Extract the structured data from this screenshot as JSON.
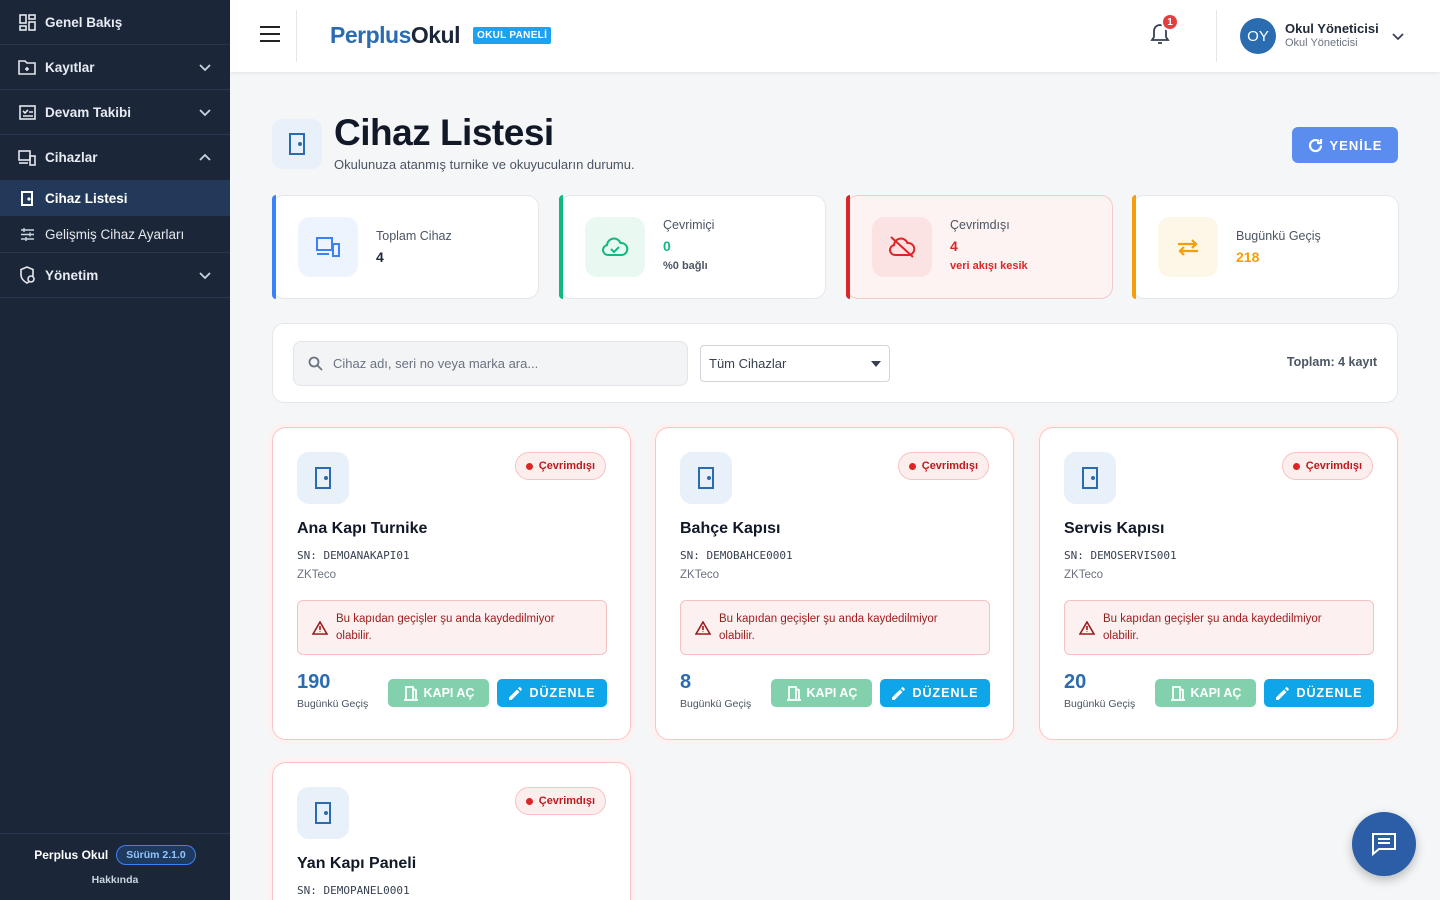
{
  "sidebar": {
    "items": [
      {
        "label": "Genel Bakış",
        "icon": "dashboard-icon"
      },
      {
        "label": "Kayıtlar",
        "icon": "folder-icon"
      },
      {
        "label": "Devam Takibi",
        "icon": "attendance-icon"
      },
      {
        "label": "Cihazlar",
        "icon": "devices-icon"
      },
      {
        "label": "Yönetim",
        "icon": "admin-icon"
      }
    ],
    "subitems": [
      {
        "label": "Cihaz Listesi",
        "icon": "door-icon",
        "active": true
      },
      {
        "label": "Gelişmiş Cihaz Ayarları",
        "icon": "sliders-icon",
        "active": false
      }
    ],
    "footer": {
      "app_name": "Perplus Okul",
      "version": "Sürüm 2.1.0",
      "about": "Hakkında"
    }
  },
  "header": {
    "logo_part1": "Perplus",
    "logo_part2": "Okul",
    "logo_badge": "OKUL PANELİ",
    "notification_count": "1",
    "user": {
      "initials": "OY",
      "name": "Okul Yöneticisi",
      "role": "Okul Yöneticisi"
    }
  },
  "page": {
    "title": "Cihaz Listesi",
    "subtitle": "Okulunuza atanmış turnike ve okuyucuların durumu.",
    "refresh_label": "YENİLE"
  },
  "stats": [
    {
      "label": "Toplam Cihaz",
      "value": "4",
      "note": "",
      "color": "#3b82f6"
    },
    {
      "label": "Çevrimiçi",
      "value": "0",
      "note": "%0 bağlı",
      "color": "#10b981"
    },
    {
      "label": "Çevrimdışı",
      "value": "4",
      "note": "veri akışı kesik",
      "color": "#dc2626"
    },
    {
      "label": "Bugünkü Geçiş",
      "value": "218",
      "note": "",
      "color": "#f59e0b"
    }
  ],
  "filter": {
    "search_placeholder": "Cihaz adı, seri no veya marka ara...",
    "select_value": "Tüm Cihazlar",
    "total_label": "Toplam: 4 kayıt"
  },
  "devices": [
    {
      "name": "Ana Kapı Turnike",
      "sn": "SN: DEMOANAKAPI01",
      "brand": "ZKTeco",
      "status": "Çevrimdışı",
      "warning": "Bu kapıdan geçişler şu anda kaydedilmiyor olabilir.",
      "passes": "190",
      "passes_label": "Bugünkü Geçiş",
      "open_label": "KAPI AÇ",
      "edit_label": "DÜZENLE"
    },
    {
      "name": "Bahçe Kapısı",
      "sn": "SN: DEMOBAHCE0001",
      "brand": "ZKTeco",
      "status": "Çevrimdışı",
      "warning": "Bu kapıdan geçişler şu anda kaydedilmiyor olabilir.",
      "passes": "8",
      "passes_label": "Bugünkü Geçiş",
      "open_label": "KAPI AÇ",
      "edit_label": "DÜZENLE"
    },
    {
      "name": "Servis Kapısı",
      "sn": "SN: DEMOSERVIS001",
      "brand": "ZKTeco",
      "status": "Çevrimdışı",
      "warning": "Bu kapıdan geçişler şu anda kaydedilmiyor olabilir.",
      "passes": "20",
      "passes_label": "Bugünkü Geçiş",
      "open_label": "KAPI AÇ",
      "edit_label": "DÜZENLE"
    },
    {
      "name": "Yan Kapı Paneli",
      "sn": "SN: DEMOPANEL0001",
      "status": "Çevrimdışı"
    }
  ]
}
